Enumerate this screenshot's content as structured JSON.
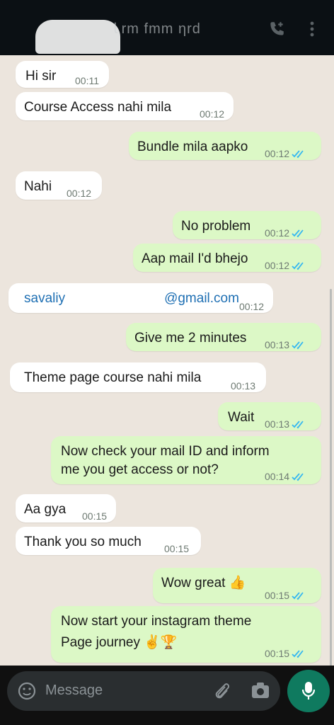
{
  "header": {
    "title": "ﺎ rm fmm ηrd",
    "call_icon": "call-add-icon",
    "menu_icon": "more-vert-icon"
  },
  "messages": [
    {
      "dir": "in",
      "text": "Hi sir",
      "time": "00:11"
    },
    {
      "dir": "in",
      "text": "Course Access nahi mila",
      "time": "00:12"
    },
    {
      "dir": "out",
      "text": "Bundle mila aapko",
      "time": "00:12"
    },
    {
      "dir": "in",
      "text": "Nahi",
      "time": "00:12"
    },
    {
      "dir": "out",
      "text": "No problem",
      "time": "00:12"
    },
    {
      "dir": "out",
      "text": "Aap mail I'd bhejo",
      "time": "00:12"
    },
    {
      "dir": "in",
      "text_start": "savaliy",
      "text_end": "@gmail.com",
      "time": "00:12"
    },
    {
      "dir": "out",
      "text": "Give me 2 minutes",
      "time": "00:13"
    },
    {
      "dir": "in",
      "text": "Theme page course nahi mila",
      "time": "00:13"
    },
    {
      "dir": "out",
      "text": "Wait",
      "time": "00:13"
    },
    {
      "dir": "out",
      "line1": "Now check your mail ID and inform",
      "line2": "me you get access or not?",
      "time": "00:14"
    },
    {
      "dir": "in",
      "text": "Aa gya",
      "time": "00:15"
    },
    {
      "dir": "in",
      "text": "Thank you so much",
      "time": "00:15"
    },
    {
      "dir": "out",
      "text": "Wow great 👍",
      "time": "00:15"
    },
    {
      "dir": "out",
      "line1": "Now start your instagram theme",
      "line2": "Page journey ✌🏆",
      "time": "00:15"
    }
  ],
  "composer": {
    "placeholder": "Message"
  },
  "colors": {
    "incoming": "#ffffff",
    "outgoing": "#dcf8c6",
    "tick": "#34b7f1",
    "mic": "#0f7a5f"
  }
}
